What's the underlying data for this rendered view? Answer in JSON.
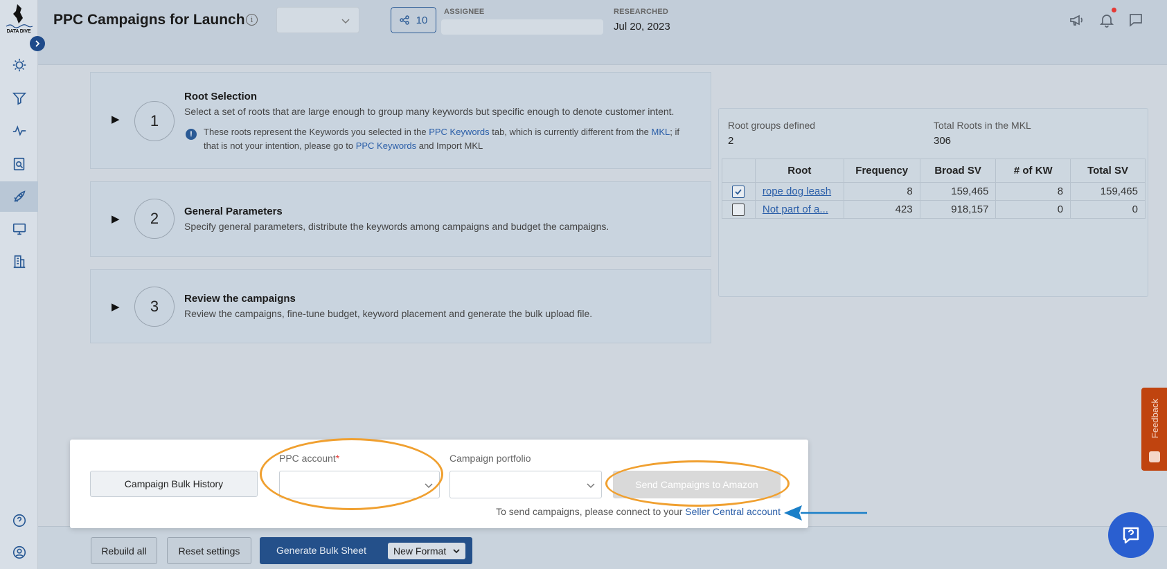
{
  "logo": {
    "text": "DATA DIVE"
  },
  "header": {
    "title": "PPC Campaigns for Launch",
    "share_count": "10",
    "assignee_label": "ASSIGNEE",
    "researched_label": "RESEARCHED",
    "researched_date": "Jul 20, 2023"
  },
  "steps": [
    {
      "number": "1",
      "title": "Root Selection",
      "description": "Select a set of roots that are large enough to group many keywords but specific enough to denote customer intent.",
      "note_part1": "These roots represent the Keywords you selected in the ",
      "note_link1": "PPC Keywords",
      "note_part2": "  tab, which is currently different from the ",
      "note_link2": "MKL",
      "note_part3": "; if that is not your intention, please go to ",
      "note_link3": "PPC Keywords",
      "note_part4": " and Import MKL"
    },
    {
      "number": "2",
      "title": "General Parameters",
      "description": "Specify general parameters, distribute the keywords among campaigns and budget the campaigns."
    },
    {
      "number": "3",
      "title": "Review the campaigns",
      "description": "Review the campaigns, fine-tune budget, keyword placement and generate the bulk upload file."
    }
  ],
  "panel": {
    "root_groups_label": "Root groups defined",
    "root_groups_value": "2",
    "total_roots_label": "Total Roots in the MKL",
    "total_roots_value": "306",
    "columns": [
      "Root",
      "Frequency",
      "Broad SV",
      "# of KW",
      "Total SV"
    ],
    "rows": [
      {
        "checked": true,
        "root": "rope dog leash",
        "frequency": "8",
        "broad_sv": "159,465",
        "kw": "8",
        "total_sv": "159,465"
      },
      {
        "checked": false,
        "root": "Not part of a...",
        "frequency": "423",
        "broad_sv": "918,157",
        "kw": "0",
        "total_sv": "0"
      }
    ]
  },
  "modal": {
    "history_button": "Campaign Bulk History",
    "ppc_account_label": "PPC account",
    "required_mark": "*",
    "portfolio_label": "Campaign portfolio",
    "send_button": "Send Campaigns to Amazon",
    "connect_text": "To send campaigns, please connect to your ",
    "connect_link": "Seller Central account"
  },
  "bottom": {
    "rebuild_label": "Rebuild all",
    "reset_label": "Reset settings",
    "generate_label": "Generate Bulk Sheet",
    "format_label": "New Format"
  },
  "feedback": {
    "label": "Feedback"
  },
  "colors": {
    "accent": "#2a5a95",
    "highlight": "#f0a030",
    "arrow": "#1a7fc8",
    "feedback": "#c0440f"
  },
  "icons": [
    "lightbulb-icon",
    "filter-icon",
    "activity-icon",
    "search-doc-icon",
    "rocket-icon",
    "monitor-icon",
    "building-icon",
    "help-icon",
    "user-icon",
    "megaphone-icon",
    "bell-icon",
    "chat-icon"
  ]
}
